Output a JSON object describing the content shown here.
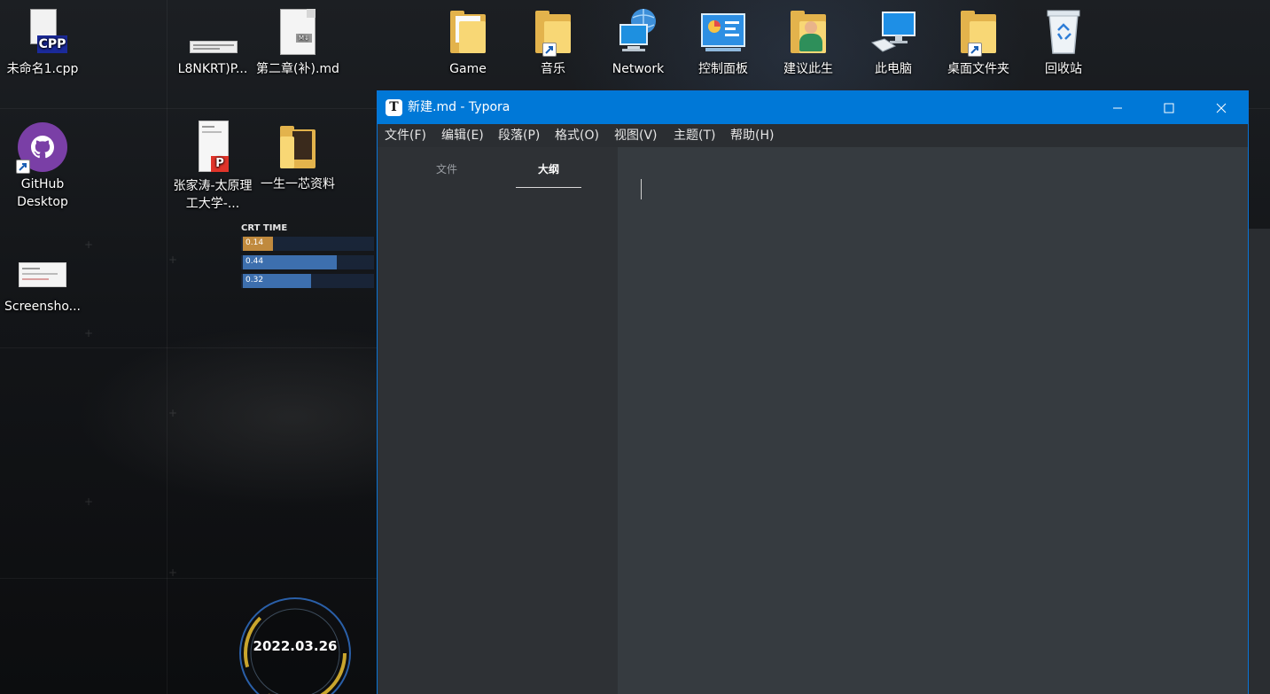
{
  "desktop": {
    "icons": [
      {
        "label": "未命名1.cpp",
        "icon": "cpp-file-icon"
      },
      {
        "label": "L8NKRT)P...",
        "icon": "image-file-icon"
      },
      {
        "label": "第二章(补).md",
        "icon": "markdown-file-icon"
      },
      {
        "label": "Game",
        "icon": "folder-icon"
      },
      {
        "label": "音乐",
        "icon": "folder-shortcut-icon"
      },
      {
        "label": "Network",
        "icon": "network-icon"
      },
      {
        "label": "控制面板",
        "icon": "control-panel-icon"
      },
      {
        "label": "建议此生",
        "icon": "user-folder-icon"
      },
      {
        "label": "此电脑",
        "icon": "computer-icon"
      },
      {
        "label": "桌面文件夹",
        "icon": "folder-shortcut-icon"
      },
      {
        "label": "回收站",
        "icon": "recycle-bin-icon"
      },
      {
        "label": "GitHub Desktop",
        "icon": "github-icon"
      },
      {
        "label": "张家涛-太原理工大学-...",
        "icon": "pdf-file-icon"
      },
      {
        "label": "一生一芯资料",
        "icon": "folder-icon"
      },
      {
        "label": "Screensho...",
        "icon": "screenshot-file-icon"
      }
    ]
  },
  "widget": {
    "title": "CRT TIME",
    "bars": [
      {
        "value": "0.14",
        "color": "#c08a3e"
      },
      {
        "value": "0.44",
        "color": "#3d6fae"
      },
      {
        "value": "0.32",
        "color": "#3d6fae"
      }
    ],
    "date": "2022.03.26"
  },
  "window": {
    "title": "新建.md - Typora",
    "app_icon_letter": "T",
    "menu": [
      "文件(F)",
      "编辑(E)",
      "段落(P)",
      "格式(O)",
      "视图(V)",
      "主题(T)",
      "帮助(H)"
    ],
    "sidebar": {
      "tabs": [
        "文件",
        "大纲"
      ],
      "active_tab": "大纲"
    },
    "colors": {
      "titlebar": "#0078d7",
      "menubar": "#2b2e32",
      "sidebar": "#2e3135",
      "editor": "#363b40"
    }
  }
}
